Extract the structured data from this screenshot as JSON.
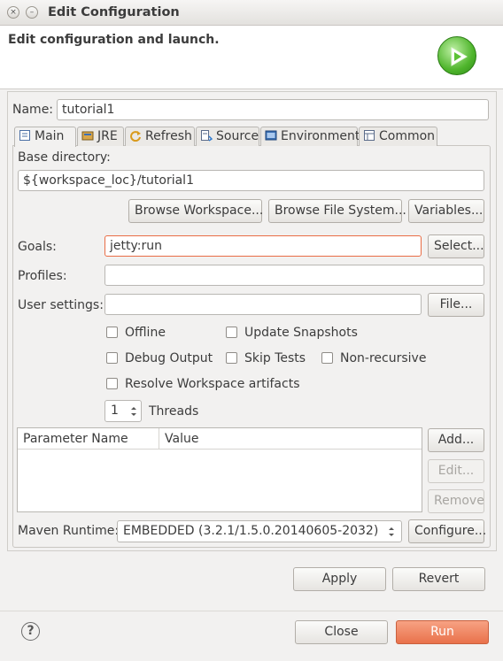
{
  "window": {
    "title": "Edit Configuration",
    "close_glyph": "×",
    "minimize_glyph": "–"
  },
  "header": {
    "title": "Edit configuration and launch."
  },
  "name": {
    "label": "Name:",
    "value": "tutorial1"
  },
  "tabs": [
    {
      "label": "Main",
      "icon": "main-tab-icon",
      "active": true
    },
    {
      "label": "JRE",
      "icon": "jre-icon",
      "active": false
    },
    {
      "label": "Refresh",
      "icon": "refresh-icon",
      "active": false
    },
    {
      "label": "Source",
      "icon": "source-icon",
      "active": false
    },
    {
      "label": "Environment",
      "icon": "environment-icon",
      "active": false
    },
    {
      "label": "Common",
      "icon": "common-icon",
      "active": false
    }
  ],
  "base_directory": {
    "label": "Base directory:",
    "value": "${workspace_loc}/tutorial1",
    "browse_workspace": "Browse Workspace...",
    "browse_filesystem": "Browse File System...",
    "variables": "Variables..."
  },
  "goals": {
    "label": "Goals:",
    "value": "jetty:run",
    "button": "Select..."
  },
  "profiles": {
    "label": "Profiles:",
    "value": ""
  },
  "user_settings": {
    "label": "User settings:",
    "value": "",
    "button": "File..."
  },
  "options": {
    "offline": {
      "label": "Offline",
      "checked": false
    },
    "update_snapshots": {
      "label": "Update Snapshots",
      "checked": false
    },
    "debug_output": {
      "label": "Debug Output",
      "checked": false
    },
    "skip_tests": {
      "label": "Skip Tests",
      "checked": false
    },
    "non_recursive": {
      "label": "Non-recursive",
      "checked": false
    },
    "resolve_workspace": {
      "label": "Resolve Workspace artifacts",
      "checked": false
    }
  },
  "threads": {
    "value": "1",
    "label": "Threads"
  },
  "parameters": {
    "columns": [
      "Parameter Name",
      "Value"
    ],
    "rows": [],
    "add": "Add...",
    "edit": "Edit...",
    "remove": "Remove"
  },
  "maven_runtime": {
    "label": "Maven Runtime:",
    "value": "EMBEDDED (3.2.1/1.5.0.20140605-2032)",
    "button": "Configure..."
  },
  "actions": {
    "apply": "Apply",
    "revert": "Revert"
  },
  "footer": {
    "help_glyph": "?",
    "close": "Close",
    "run": "Run"
  },
  "colors": {
    "accent": "#e9714b",
    "focus_border": "#e96d46",
    "background": "#f2f1f0"
  }
}
